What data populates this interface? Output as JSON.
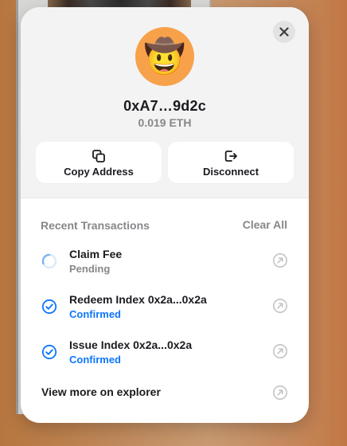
{
  "account": {
    "avatar_emoji": "🤠",
    "address": "0xA7…9d2c",
    "balance": "0.019 ETH"
  },
  "actions": {
    "copy_label": "Copy Address",
    "disconnect_label": "Disconnect"
  },
  "transactions": {
    "section_title": "Recent Transactions",
    "clear_label": "Clear All",
    "items": [
      {
        "title": "Claim Fee",
        "status": "Pending",
        "state": "pending"
      },
      {
        "title": "Redeem Index 0x2a...0x2a",
        "status": "Confirmed",
        "state": "confirmed"
      },
      {
        "title": "Issue Index 0x2a...0x2a",
        "status": "Confirmed",
        "state": "confirmed"
      }
    ],
    "explorer_label": "View more on explorer"
  },
  "colors": {
    "accent_blue": "#0e76fd",
    "muted_text": "#86878a",
    "primary_text": "#1a1b1f",
    "avatar_bg": "#f7a14a"
  },
  "icons": {
    "close": "close-icon",
    "copy": "copy-icon",
    "disconnect": "disconnect-icon",
    "pending": "spinner-icon",
    "confirmed": "check-circle-icon",
    "external": "external-link-icon"
  }
}
